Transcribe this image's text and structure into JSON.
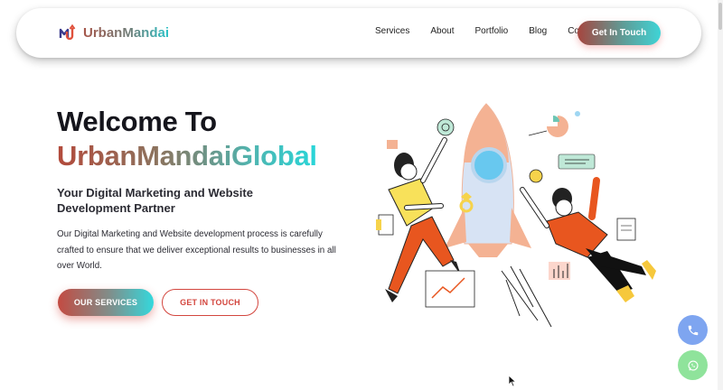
{
  "brand": {
    "name": "UrbanMandai",
    "logo_icon": "um-logo-icon"
  },
  "nav": {
    "links": [
      "Services",
      "About",
      "Portfolio",
      "Blog",
      "Contact"
    ],
    "cta_label": "Get In Touch"
  },
  "hero": {
    "title_line1": "Welcome To",
    "title_line2": "UrbanMandaiGlobal",
    "subtitle": "Your Digital Marketing and Website Development Partner",
    "description": "Our Digital Marketing and Website development process is carefully crafted to ensure that we deliver exceptional results to businesses in all over World.",
    "primary_button": "OUR SERVICES",
    "secondary_button": "GET IN TOUCH"
  },
  "illustration": {
    "icon": "rocket-team-illustration"
  },
  "floating": {
    "phone_icon": "phone-icon",
    "whatsapp_icon": "whatsapp-icon"
  },
  "colors": {
    "accent_red": "#d3463e",
    "accent_teal": "#2cc3c8",
    "rocket_orange": "#f4a98a",
    "figure_orange": "#e8561f",
    "figure_yellow": "#f8e15a",
    "phone_fab": "#7ea5f0",
    "whatsapp_fab": "#8fe39b"
  }
}
